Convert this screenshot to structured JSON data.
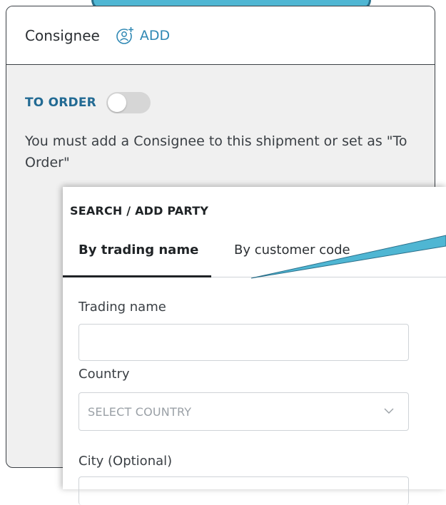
{
  "consignee": {
    "title": "Consignee",
    "add_label": "ADD",
    "to_order_label": "TO ORDER",
    "to_order_enabled": false,
    "notice": "You must add a Consignee to this shipment or set as \"To Order\""
  },
  "panel": {
    "title": "SEARCH / ADD PARTY",
    "tabs": [
      {
        "label": "By trading name",
        "active": true
      },
      {
        "label": "By customer code",
        "active": false
      }
    ],
    "fields": {
      "trading_name_label": "Trading name",
      "trading_name_value": "",
      "country_label": "Country",
      "country_placeholder": "SELECT COUNTRY",
      "city_label": "City (Optional)"
    }
  },
  "colors": {
    "accent": "#2f88b4",
    "callout": "#4fb6d3",
    "toggle_off": "#d6d6d6"
  }
}
